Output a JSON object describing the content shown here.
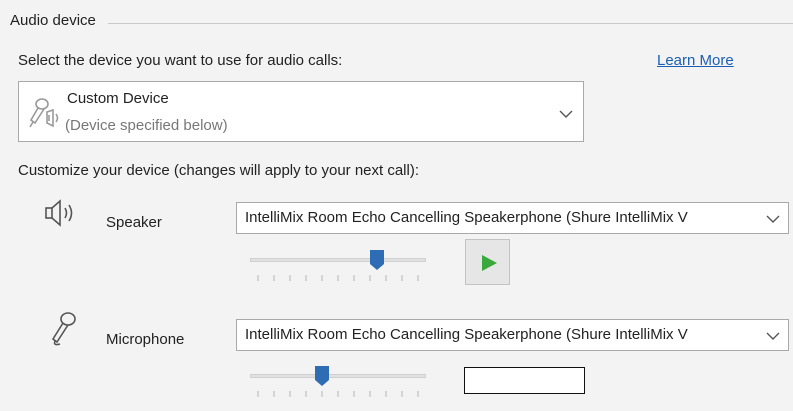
{
  "section": {
    "title": "Audio device"
  },
  "select_prompt": "Select the device you want to use for audio calls:",
  "learn_more_label": "Learn More",
  "device_dropdown": {
    "name": "Custom Device",
    "subtitle": "(Device specified below)"
  },
  "customize_prompt": "Customize your device (changes will apply to your next call):",
  "speaker": {
    "label": "Speaker",
    "selected_device": "IntelliMix Room Echo Cancelling Speakerphone (Shure IntelliMix V",
    "volume_fraction": 0.72
  },
  "microphone": {
    "label": "Microphone",
    "selected_device": "IntelliMix Room Echo Cancelling Speakerphone (Shure IntelliMix V",
    "volume_fraction": 0.41
  },
  "icons": {
    "device": "headset-mic-icon",
    "speaker": "speaker-icon",
    "microphone": "microphone-icon",
    "dropdown": "chevron-down-icon",
    "play": "play-icon"
  },
  "colors": {
    "link": "#1a5fb4",
    "slider_thumb": "#2e6db4",
    "play_green": "#3aa83a",
    "panel_bg": "#f3f3f3"
  }
}
